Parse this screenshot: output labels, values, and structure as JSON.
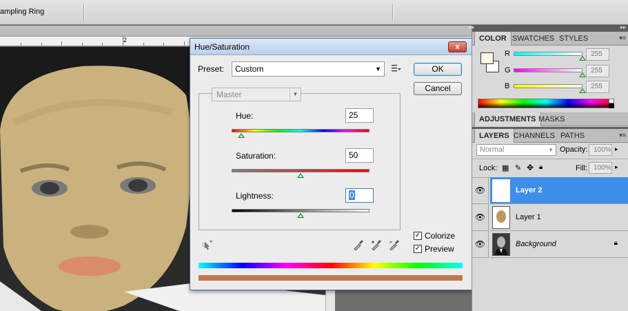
{
  "options_bar": {
    "sample_ring_label": "ampling Ring"
  },
  "ruler": {
    "marker": "2"
  },
  "dialog": {
    "title": "Hue/Saturation",
    "close_label": "x",
    "preset_label": "Preset:",
    "preset_value": "Custom",
    "ok_label": "OK",
    "cancel_label": "Cancel",
    "edit_value": "Master",
    "hue_label": "Hue:",
    "hue_value": "25",
    "saturation_label": "Saturation:",
    "saturation_value": "50",
    "lightness_label": "Lightness:",
    "lightness_value": "0",
    "hue_range": [
      -180,
      180
    ],
    "saturation_range": [
      0,
      100
    ],
    "lightness_range": [
      -100,
      100
    ],
    "colorize_label": "Colorize",
    "colorize_checked": true,
    "preview_label": "Preview",
    "preview_checked": true,
    "colorize_result_color": "#bb7a4f"
  },
  "color_panel": {
    "tabs": [
      "COLOR",
      "SWATCHES",
      "STYLES"
    ],
    "channels": [
      {
        "label": "R",
        "value": "255",
        "color": "#00e5e5"
      },
      {
        "label": "G",
        "value": "255",
        "color": "#e000e0"
      },
      {
        "label": "B",
        "value": "255",
        "color": "#e0e000"
      }
    ]
  },
  "adjustments_panel": {
    "tabs": [
      "ADJUSTMENTS",
      "MASKS"
    ]
  },
  "layers_panel": {
    "tabs": [
      "LAYERS",
      "CHANNELS",
      "PATHS"
    ],
    "blend_mode": "Normal",
    "opacity_label": "Opacity:",
    "opacity_value": "100%",
    "lock_label": "Lock:",
    "fill_label": "Fill:",
    "fill_value": "100%",
    "layers": [
      {
        "name": "Layer 2",
        "selected": true
      },
      {
        "name": "Layer 1",
        "selected": false
      },
      {
        "name": "Background",
        "selected": false
      }
    ]
  },
  "colors": {
    "selection_blue": "#3d8ee8",
    "title_blue": "#c5d8ee"
  }
}
